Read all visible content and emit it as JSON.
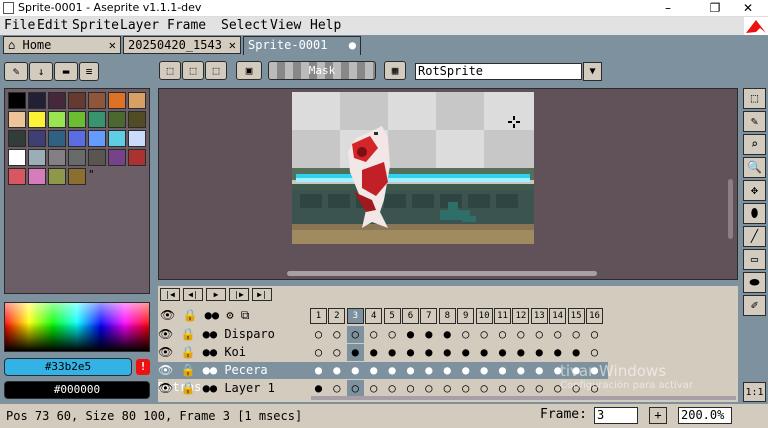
{
  "window": {
    "title": "Sprite-0001 - Aseprite v1.1.1-dev",
    "minimize": "–",
    "maximize": "❐",
    "close": "✕"
  },
  "menu": [
    "File",
    "Edit",
    "Sprite",
    "Layer",
    "Frame",
    "Select",
    "View",
    "Help"
  ],
  "tabs": [
    {
      "icon": "⌂",
      "label": "Home",
      "close": "✕"
    },
    {
      "label": "20250420_1543",
      "close": "✕"
    },
    {
      "label": "Sprite-0001",
      "close": "●"
    }
  ],
  "toolbar": {
    "mask_label": "Mask",
    "rotation_algorithm": "RotSprite",
    "dropdown_arrow": "▼"
  },
  "palette": {
    "more": "\"",
    "colors": [
      "#000000",
      "#222034",
      "#45283c",
      "#663931",
      "#8f563b",
      "#df7126",
      "#d9a066",
      "#eec39a",
      "#fbf236",
      "#99e550",
      "#6abe30",
      "#37946e",
      "#4b692f",
      "#524b24",
      "#323c39",
      "#3f3f74",
      "#306082",
      "#5b6ee1",
      "#639bff",
      "#5fcde4",
      "#cbdbfc",
      "#ffffff",
      "#9badb7",
      "#847e87",
      "#696a6a",
      "#595652",
      "#76428a",
      "#ac3232",
      "#d95763",
      "#d77bba",
      "#8f974a",
      "#8a6f30"
    ]
  },
  "colors": {
    "fg_hex": "#33b2e5",
    "bg_hex": "#000000",
    "warn": "!"
  },
  "timeline": {
    "frames": [
      "1",
      "2",
      "3",
      "4",
      "5",
      "6",
      "7",
      "8",
      "9",
      "10",
      "11",
      "12",
      "13",
      "14",
      "15",
      "16"
    ],
    "current_frame_index": 2,
    "layers": [
      {
        "name": "Disparo",
        "cels": [
          "○",
          "○",
          "○",
          "○",
          "○",
          "●",
          "●",
          "●",
          "○",
          "○",
          "○",
          "○",
          "○",
          "○",
          "○",
          "○"
        ]
      },
      {
        "name": "Koi",
        "cels": [
          "○",
          "○",
          "●",
          "●",
          "●",
          "●",
          "●",
          "●",
          "●",
          "●",
          "●",
          "●",
          "●",
          "●",
          "●",
          "○"
        ]
      },
      {
        "name": "Pecera Detras",
        "cels": [
          "●",
          "●",
          "●",
          "●",
          "●",
          "●",
          "●",
          "●",
          "●",
          "●",
          "●",
          "●",
          "●",
          "●",
          "●",
          "●"
        ],
        "selected": true
      },
      {
        "name": "Layer 1",
        "cels": [
          "●",
          "○",
          "○",
          "○",
          "○",
          "○",
          "○",
          "○",
          "○",
          "○",
          "○",
          "○",
          "○",
          "○",
          "○",
          "○"
        ]
      }
    ]
  },
  "status": {
    "text": "Pos 73 60, Size 80 100, Frame 3 [1 msecs]",
    "frame_label": "Frame:",
    "frame_value": "3",
    "plus": "+",
    "zoom": "200.0%"
  },
  "watermark": {
    "line1": "tivar Windows",
    "line2": "Configuración para activar"
  },
  "right_tools": [
    "rectangular-marquee",
    "pencil",
    "eyedropper",
    "zoom",
    "move",
    "paint-bucket",
    "line",
    "rectangle",
    "ellipse-fill",
    "brush-settings"
  ],
  "one_to_one": "1:1"
}
